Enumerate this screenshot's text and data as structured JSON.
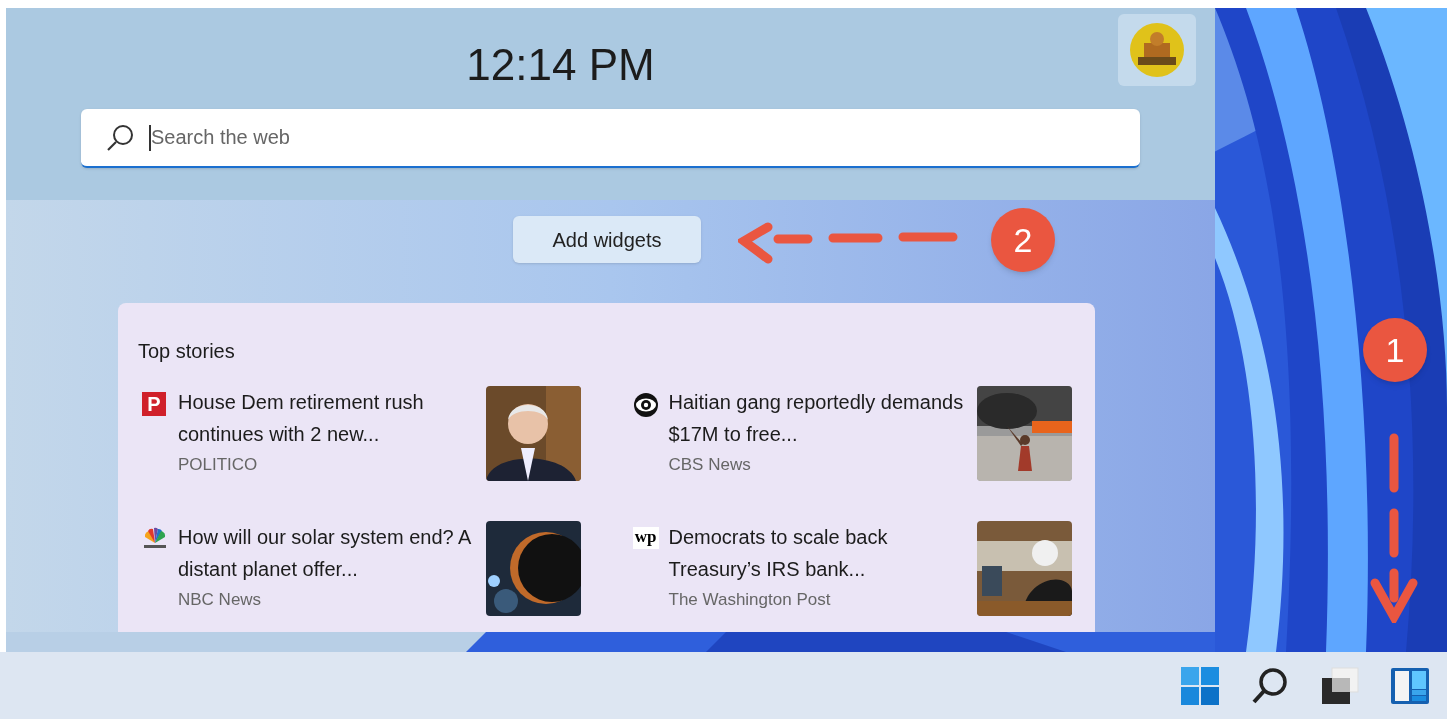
{
  "clock": "12:14 PM",
  "search": {
    "placeholder": "Search the web"
  },
  "add_widgets_button": "Add widgets",
  "top_stories": {
    "title": "Top stories",
    "stories": [
      {
        "title": "House Dem retirement rush continues with 2 new...",
        "source": "POLITICO",
        "icon": {
          "kind": "letter",
          "text": "P"
        }
      },
      {
        "title": "Haitian gang reportedly demands $17M to free...",
        "source": "CBS News",
        "icon": {
          "kind": "eye"
        }
      },
      {
        "title": "How will our solar system end? A distant planet offer...",
        "source": "NBC News",
        "icon": {
          "kind": "peacock"
        }
      },
      {
        "title": "Democrats to scale back Treasury’s IRS bank...",
        "source": "The Washington Post",
        "icon": {
          "kind": "blackletter",
          "text": "wp"
        }
      }
    ]
  },
  "annotations": [
    {
      "number": "2",
      "kind": "left"
    },
    {
      "number": "1",
      "kind": "down"
    }
  ]
}
